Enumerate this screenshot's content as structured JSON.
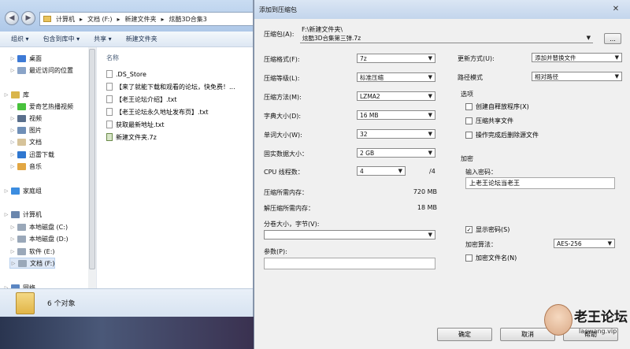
{
  "explorer": {
    "address_path": [
      "计算机",
      "文档 (F:)",
      "新建文件夹",
      "炫酷3D合集3"
    ],
    "toolbar": [
      "组织 ▾",
      "包含到库中 ▾",
      "共享 ▾",
      "新建文件夹"
    ],
    "nav": {
      "items": [
        {
          "label": "桌面",
          "color": "#3d7ad6",
          "indent": 1
        },
        {
          "label": "最近访问的位置",
          "color": "#8aa4c8",
          "indent": 1
        },
        {
          "label": "库",
          "color": "#d9b54a",
          "indent": 0
        },
        {
          "label": "爱奇艺热播视频",
          "color": "#49c23c",
          "indent": 1
        },
        {
          "label": "视频",
          "color": "#5a6f8c",
          "indent": 1
        },
        {
          "label": "图片",
          "color": "#6f8fb7",
          "indent": 1
        },
        {
          "label": "文档",
          "color": "#d6c39a",
          "indent": 1
        },
        {
          "label": "迅雷下载",
          "color": "#2f77d0",
          "indent": 1
        },
        {
          "label": "音乐",
          "color": "#e2a743",
          "indent": 1
        },
        {
          "label": "家庭组",
          "color": "#3c8de0",
          "indent": 0
        },
        {
          "label": "计算机",
          "color": "#6b87ad",
          "indent": 0
        },
        {
          "label": "本地磁盘 (C:)",
          "color": "#9aa8b9",
          "indent": 1
        },
        {
          "label": "本地磁盘 (D:)",
          "color": "#9aa8b9",
          "indent": 1
        },
        {
          "label": "软件 (E:)",
          "color": "#9aa8b9",
          "indent": 1
        },
        {
          "label": "文档 (F:)",
          "color": "#9aa8b9",
          "indent": 1
        },
        {
          "label": "网络",
          "color": "#5a86c2",
          "indent": 0
        }
      ]
    },
    "column_header": "名称",
    "files": [
      {
        "name": ".DS_Store",
        "type": "file"
      },
      {
        "name": "【来了就能下载和观看的论坛，快免费！...",
        "type": "file"
      },
      {
        "name": "【老王论坛介绍】.txt",
        "type": "file"
      },
      {
        "name": "【老王论坛永久地址发布页】.txt",
        "type": "file"
      },
      {
        "name": "获取最新地址.txt",
        "type": "file"
      },
      {
        "name": "新建文件夹.7z",
        "type": "archive"
      }
    ],
    "status": "6 个对象"
  },
  "dialog": {
    "title": "添加到压缩包",
    "close": "✕",
    "archive_label": "压缩包(A):",
    "archive_dir": "F:\\新建文件夹\\",
    "archive_name": "炫酷3D合集第三弹.7z",
    "browse": "...",
    "left_fields": [
      {
        "label": "压缩格式(F):",
        "value": "7z"
      },
      {
        "label": "压缩等级(L):",
        "value": "标准压缩"
      },
      {
        "label": "压缩方法(M):",
        "value": "LZMA2"
      },
      {
        "label": "字典大小(D):",
        "value": "16 MB"
      },
      {
        "label": "单词大小(W):",
        "value": "32"
      },
      {
        "label": "固实数据大小：",
        "value": "2 GB"
      }
    ],
    "cpu": {
      "label": "CPU 线程数：",
      "value": "4",
      "total": "/4"
    },
    "memory": [
      {
        "label": "压缩所需内存：",
        "value": "720 MB"
      },
      {
        "label": "解压缩所需内存：",
        "value": "18 MB"
      }
    ],
    "split_label": "分卷大小，字节(V):",
    "params_label": "参数(P):",
    "update_mode_label": "更新方式(U):",
    "update_mode": "添加并替换文件",
    "path_mode_label": "路径模式",
    "path_mode": "相对路径",
    "options_label": "选项",
    "options": [
      {
        "label": "创建自释放程序(X)",
        "checked": ""
      },
      {
        "label": "压缩共享文件",
        "checked": ""
      },
      {
        "label": "操作完成后删除源文件",
        "checked": ""
      }
    ],
    "encrypt_label": "加密",
    "password_label": "输入密码：",
    "password": "上老王论坛当老王",
    "show_password": {
      "label": "显示密码(S)",
      "checked": "✓"
    },
    "enc_method_label": "加密算法：",
    "enc_method": "AES-256",
    "encrypt_names": {
      "label": "加密文件名(N)",
      "checked": ""
    },
    "ok": "确定",
    "cancel": "取消",
    "help": "帮助"
  },
  "watermark": {
    "name": "老王论坛",
    "site": "laowang.vip"
  }
}
